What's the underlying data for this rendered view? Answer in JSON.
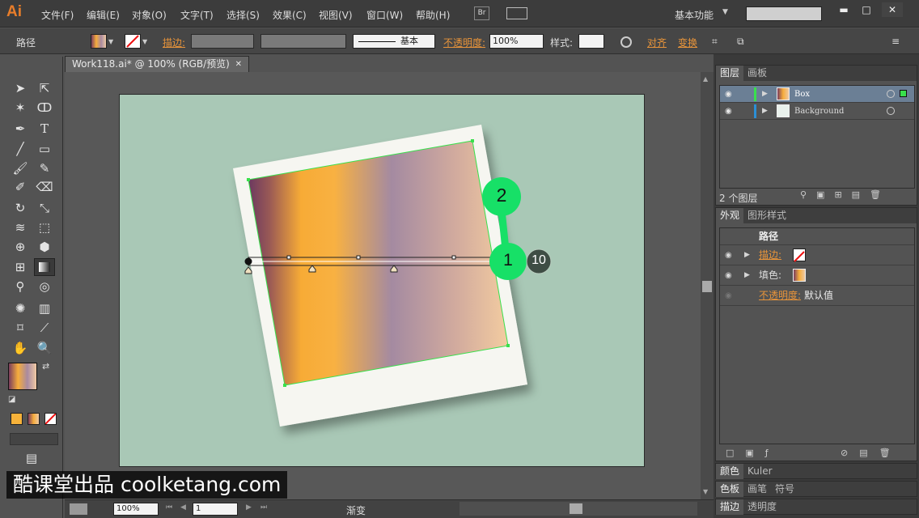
{
  "app": {
    "logo": "Ai",
    "menus": [
      "文件(F)",
      "编辑(E)",
      "对象(O)",
      "文字(T)",
      "选择(S)",
      "效果(C)",
      "视图(V)",
      "窗口(W)",
      "帮助(H)"
    ],
    "bridge": "Br",
    "workspace": "基本功能",
    "win_buttons": [
      "▬",
      "□",
      "✕"
    ]
  },
  "control": {
    "selection_type": "路径",
    "stroke_label": "描边:",
    "stroke_style": "基本",
    "opacity_label": "不透明度:",
    "opacity_value": "100%",
    "style_label": "样式:",
    "align_label": "对齐",
    "transform_label": "变换"
  },
  "document": {
    "tab_title": "Work118.ai* @ 100% (RGB/预览)",
    "close": "✕"
  },
  "callouts": {
    "one": "1",
    "two": "2",
    "ten": "10"
  },
  "layers_panel": {
    "tabs": [
      "图层",
      "画板"
    ],
    "layers": [
      {
        "name": "Box"
      },
      {
        "name": "Background"
      }
    ],
    "count": "2 个图层"
  },
  "appearance_panel": {
    "tabs": [
      "外观",
      "图形样式"
    ],
    "title": "路径",
    "stroke_label": "描边:",
    "fill_label": "填色:",
    "opacity_label": "不透明度:",
    "opacity_value": "默认值"
  },
  "collapsed_panels": [
    [
      "颜色",
      "Kuler"
    ],
    [
      "色板",
      "画笔",
      "符号"
    ],
    [
      "描边",
      "透明度"
    ]
  ],
  "status": {
    "zoom": "100%",
    "page": "1",
    "tool": "渐变"
  },
  "watermark": "酷课堂出品 coolketang.com",
  "colors": {
    "accent": "#e8943a",
    "callout": "#17e067",
    "selection": "#39e04c",
    "artboard": "#a9c8b6"
  }
}
